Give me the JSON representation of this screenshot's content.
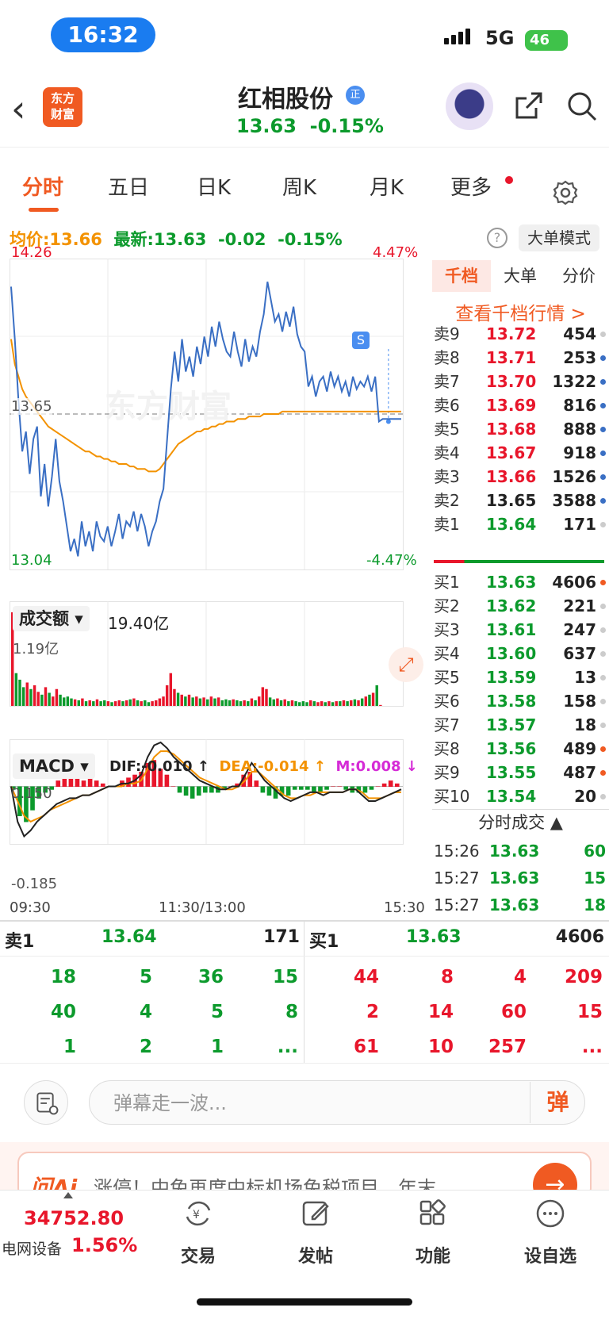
{
  "status_bar": {
    "time": "16:32",
    "network": "5G",
    "battery": "46"
  },
  "header": {
    "logo_line1": "东方",
    "logo_line2": "财富",
    "stock_name": "红相股份",
    "badge": "正",
    "price": "13.63",
    "change_pct": "-0.15%"
  },
  "tabs": [
    {
      "label": "分时",
      "active": true
    },
    {
      "label": "五日"
    },
    {
      "label": "日K"
    },
    {
      "label": "周K"
    },
    {
      "label": "月K"
    },
    {
      "label": "更多"
    }
  ],
  "info": {
    "avg_label": "均价:",
    "avg_value": "13.66",
    "latest_label": "最新:",
    "latest_value": "13.63",
    "change": "-0.02",
    "change_pct": "-0.15%",
    "help": "?",
    "mode_button": "大单模式"
  },
  "chart_data": {
    "type": "line",
    "title": "分时",
    "y_max_label": "14.26",
    "y_min_label": "13.04",
    "pct_max_label": "4.47%",
    "pct_min_label": "-4.47%",
    "prev_close_label": "13.65",
    "ylim": [
      13.04,
      14.26
    ],
    "prev_close": 13.65,
    "sell_marker": "S",
    "watermark": "东方财富",
    "x_ticks": [
      "09:30",
      "11:30/13:00",
      "15:30"
    ],
    "price_series": [
      14.16,
      13.95,
      13.7,
      13.5,
      13.58,
      13.41,
      13.55,
      13.6,
      13.32,
      13.45,
      13.28,
      13.4,
      13.55,
      13.38,
      13.3,
      13.2,
      13.1,
      13.15,
      13.08,
      13.22,
      13.12,
      13.18,
      13.1,
      13.22,
      13.16,
      13.14,
      13.2,
      13.12,
      13.18,
      13.25,
      13.15,
      13.22,
      13.2,
      13.26,
      13.18,
      13.25,
      13.2,
      13.12,
      13.18,
      13.22,
      13.3,
      13.35,
      13.55,
      13.75,
      13.9,
      13.78,
      13.95,
      13.82,
      13.88,
      13.8,
      13.92,
      13.85,
      13.96,
      13.88,
      14.0,
      13.92,
      14.02,
      13.95,
      13.9,
      13.88,
      13.98,
      13.9,
      13.84,
      13.95,
      13.86,
      13.92,
      13.88,
      13.98,
      14.05,
      14.18,
      14.1,
      14.02,
      14.05,
      13.98,
      14.06,
      14.0,
      14.08,
      13.97,
      13.92,
      13.9,
      13.76,
      13.8,
      13.72,
      13.78,
      13.8,
      13.74,
      13.82,
      13.76,
      13.8,
      13.74,
      13.78,
      13.72,
      13.8,
      13.75,
      13.78,
      13.76,
      13.8,
      13.74,
      13.8,
      13.62,
      13.63,
      13.63,
      13.63,
      13.63,
      13.63,
      13.63
    ],
    "avg_series": [
      13.95,
      13.85,
      13.8,
      13.75,
      13.72,
      13.7,
      13.68,
      13.66,
      13.64,
      13.62,
      13.6,
      13.59,
      13.58,
      13.57,
      13.56,
      13.55,
      13.54,
      13.53,
      13.52,
      13.51,
      13.5,
      13.5,
      13.49,
      13.48,
      13.48,
      13.47,
      13.47,
      13.46,
      13.46,
      13.45,
      13.45,
      13.45,
      13.44,
      13.44,
      13.43,
      13.43,
      13.43,
      13.42,
      13.42,
      13.42,
      13.43,
      13.45,
      13.47,
      13.49,
      13.51,
      13.53,
      13.54,
      13.55,
      13.56,
      13.57,
      13.58,
      13.58,
      13.59,
      13.59,
      13.6,
      13.6,
      13.61,
      13.61,
      13.62,
      13.62,
      13.62,
      13.63,
      13.63,
      13.63,
      13.64,
      13.64,
      13.64,
      13.64,
      13.65,
      13.65,
      13.65,
      13.65,
      13.65,
      13.66,
      13.66,
      13.66,
      13.66,
      13.66,
      13.66,
      13.66,
      13.66,
      13.66,
      13.66,
      13.66,
      13.66,
      13.66,
      13.66,
      13.66,
      13.66,
      13.66,
      13.66,
      13.66,
      13.66,
      13.66,
      13.66,
      13.66,
      13.66,
      13.66,
      13.66,
      13.66,
      13.66,
      13.66,
      13.66,
      13.66,
      13.66,
      13.66
    ],
    "volume_label": "成交额",
    "volume_total": "19.40亿",
    "volume_max_label": "1.19亿",
    "volume_series": [
      1.0,
      0.35,
      0.28,
      0.2,
      0.25,
      0.18,
      0.22,
      0.15,
      0.12,
      0.2,
      0.14,
      0.1,
      0.18,
      0.12,
      0.09,
      0.1,
      0.08,
      0.07,
      0.06,
      0.08,
      0.05,
      0.06,
      0.05,
      0.07,
      0.05,
      0.06,
      0.05,
      0.04,
      0.05,
      0.06,
      0.05,
      0.06,
      0.07,
      0.08,
      0.06,
      0.05,
      0.06,
      0.04,
      0.05,
      0.06,
      0.08,
      0.1,
      0.22,
      0.35,
      0.18,
      0.14,
      0.12,
      0.1,
      0.12,
      0.09,
      0.1,
      0.08,
      0.09,
      0.07,
      0.1,
      0.08,
      0.09,
      0.06,
      0.07,
      0.06,
      0.07,
      0.06,
      0.05,
      0.06,
      0.05,
      0.08,
      0.06,
      0.1,
      0.2,
      0.18,
      0.09,
      0.07,
      0.08,
      0.06,
      0.07,
      0.05,
      0.06,
      0.05,
      0.04,
      0.05,
      0.04,
      0.06,
      0.05,
      0.04,
      0.05,
      0.04,
      0.05,
      0.04,
      0.05,
      0.05,
      0.06,
      0.05,
      0.06,
      0.07,
      0.06,
      0.08,
      0.1,
      0.12,
      0.14,
      0.22,
      0.01,
      0.0,
      0.0,
      0.0,
      0.0,
      0.0
    ],
    "macd": {
      "label": "MACD",
      "dif": "DIF:-0.010 ↑",
      "dea": "DEA:-0.014 ↑",
      "m": "M:0.008 ↓",
      "top_label": "0.150",
      "bottom_label": "-0.185",
      "ylim": [
        -0.185,
        0.15
      ],
      "dif_series": [
        0.0,
        -0.12,
        -0.17,
        -0.15,
        -0.12,
        -0.1,
        -0.08,
        -0.06,
        -0.05,
        -0.04,
        -0.04,
        -0.03,
        -0.03,
        -0.02,
        -0.01,
        0.0,
        0.0,
        0.01,
        0.01,
        0.02,
        0.04,
        0.1,
        0.14,
        0.15,
        0.13,
        0.1,
        0.08,
        0.06,
        0.04,
        0.02,
        0.01,
        0.0,
        -0.01,
        -0.01,
        0.0,
        0.0,
        0.04,
        0.08,
        0.05,
        0.02,
        0.0,
        -0.02,
        -0.04,
        -0.05,
        -0.04,
        -0.03,
        -0.02,
        -0.02,
        -0.03,
        -0.02,
        -0.02,
        -0.02,
        -0.01,
        -0.01,
        -0.03,
        -0.05,
        -0.05,
        -0.04,
        -0.03,
        -0.02,
        -0.01
      ],
      "dea_series": [
        0.0,
        -0.05,
        -0.1,
        -0.12,
        -0.11,
        -0.1,
        -0.08,
        -0.07,
        -0.06,
        -0.05,
        -0.04,
        -0.03,
        -0.03,
        -0.02,
        -0.01,
        0.0,
        0.0,
        0.0,
        0.01,
        0.01,
        0.02,
        0.06,
        0.1,
        0.12,
        0.12,
        0.11,
        0.09,
        0.07,
        0.05,
        0.03,
        0.02,
        0.01,
        0.0,
        -0.01,
        -0.01,
        0.0,
        0.02,
        0.05,
        0.05,
        0.03,
        0.01,
        -0.01,
        -0.03,
        -0.04,
        -0.04,
        -0.03,
        -0.03,
        -0.02,
        -0.02,
        -0.02,
        -0.02,
        -0.02,
        -0.01,
        -0.01,
        -0.02,
        -0.04,
        -0.04,
        -0.04,
        -0.03,
        -0.02,
        -0.02
      ],
      "hist_series": [
        -0.01,
        -0.1,
        -0.12,
        -0.08,
        -0.04,
        -0.02,
        -0.01,
        0.02,
        0.03,
        0.04,
        0.04,
        0.02,
        0.03,
        0.02,
        0.01,
        0.0,
        0.0,
        0.02,
        0.03,
        0.04,
        0.05,
        0.08,
        0.09,
        0.06,
        0.04,
        0.0,
        -0.02,
        -0.03,
        -0.04,
        -0.03,
        -0.02,
        -0.02,
        -0.02,
        -0.01,
        0.0,
        0.01,
        0.04,
        0.05,
        0.02,
        -0.02,
        -0.03,
        -0.04,
        -0.03,
        -0.03,
        -0.01,
        -0.01,
        -0.01,
        -0.02,
        -0.02,
        -0.01,
        0.0,
        0.0,
        -0.01,
        -0.02,
        -0.02,
        -0.02,
        -0.01,
        0.0,
        0.01,
        0.02,
        0.01
      ]
    }
  },
  "order_book": {
    "tabs": [
      "千档",
      "大单",
      "分价"
    ],
    "link": "查看千档行情 >",
    "sells": [
      {
        "label": "卖9",
        "price": "13.72",
        "vol": "454",
        "dot": "gray",
        "color": "red"
      },
      {
        "label": "卖8",
        "price": "13.71",
        "vol": "253",
        "dot": "blue",
        "color": "red"
      },
      {
        "label": "卖7",
        "price": "13.70",
        "vol": "1322",
        "dot": "blue",
        "color": "red"
      },
      {
        "label": "卖6",
        "price": "13.69",
        "vol": "816",
        "dot": "blue",
        "color": "red"
      },
      {
        "label": "卖5",
        "price": "13.68",
        "vol": "888",
        "dot": "blue",
        "color": "red"
      },
      {
        "label": "卖4",
        "price": "13.67",
        "vol": "918",
        "dot": "blue",
        "color": "red"
      },
      {
        "label": "卖3",
        "price": "13.66",
        "vol": "1526",
        "dot": "blue",
        "color": "red"
      },
      {
        "label": "卖2",
        "price": "13.65",
        "vol": "3588",
        "dot": "blue",
        "color": "black"
      },
      {
        "label": "卖1",
        "price": "13.64",
        "vol": "171",
        "dot": "gray",
        "color": "green"
      }
    ],
    "buys": [
      {
        "label": "买1",
        "price": "13.63",
        "vol": "4606",
        "dot": "orange"
      },
      {
        "label": "买2",
        "price": "13.62",
        "vol": "221",
        "dot": "gray"
      },
      {
        "label": "买3",
        "price": "13.61",
        "vol": "247",
        "dot": "gray"
      },
      {
        "label": "买4",
        "price": "13.60",
        "vol": "637",
        "dot": "gray"
      },
      {
        "label": "买5",
        "price": "13.59",
        "vol": "13",
        "dot": "gray"
      },
      {
        "label": "买6",
        "price": "13.58",
        "vol": "158",
        "dot": "gray"
      },
      {
        "label": "买7",
        "price": "13.57",
        "vol": "18",
        "dot": "gray"
      },
      {
        "label": "买8",
        "price": "13.56",
        "vol": "489",
        "dot": "orange"
      },
      {
        "label": "买9",
        "price": "13.55",
        "vol": "487",
        "dot": "orange"
      },
      {
        "label": "买10",
        "price": "13.54",
        "vol": "20",
        "dot": "gray"
      }
    ],
    "ticks_header": "分时成交 ▲",
    "ticks": [
      {
        "time": "15:26",
        "price": "13.63",
        "vol": "60"
      },
      {
        "time": "15:27",
        "price": "13.63",
        "vol": "15"
      },
      {
        "time": "15:27",
        "price": "13.63",
        "vol": "18"
      }
    ]
  },
  "summary": {
    "sell_label": "卖1",
    "sell_price": "13.64",
    "sell_vol": "171",
    "buy_label": "买1",
    "buy_price": "13.63",
    "buy_vol": "4606",
    "sell_queue": [
      "18",
      "5",
      "36",
      "15",
      "40",
      "4",
      "5",
      "8",
      "1",
      "2",
      "1",
      "..."
    ],
    "buy_queue": [
      "44",
      "8",
      "4",
      "209",
      "2",
      "14",
      "60",
      "15",
      "61",
      "10",
      "257",
      "..."
    ]
  },
  "danmu": {
    "placeholder": "弹幕走一波...",
    "button": "弹"
  },
  "ai_banner": {
    "logo": "问Ai",
    "text": "涨停！中免再度中标机场免税项目，年末",
    "arrow": "→"
  },
  "bottom_nav": {
    "index_value": "34752.80",
    "index_name": "电网设备",
    "index_pct": "1.56%",
    "items": [
      "交易",
      "发帖",
      "功能",
      "设自选"
    ]
  },
  "colors": {
    "red": "#e8162b",
    "green": "#0c9a2c",
    "orange": "#f39200",
    "brand": "#f05a22",
    "price_line": "#3a6fc4"
  }
}
